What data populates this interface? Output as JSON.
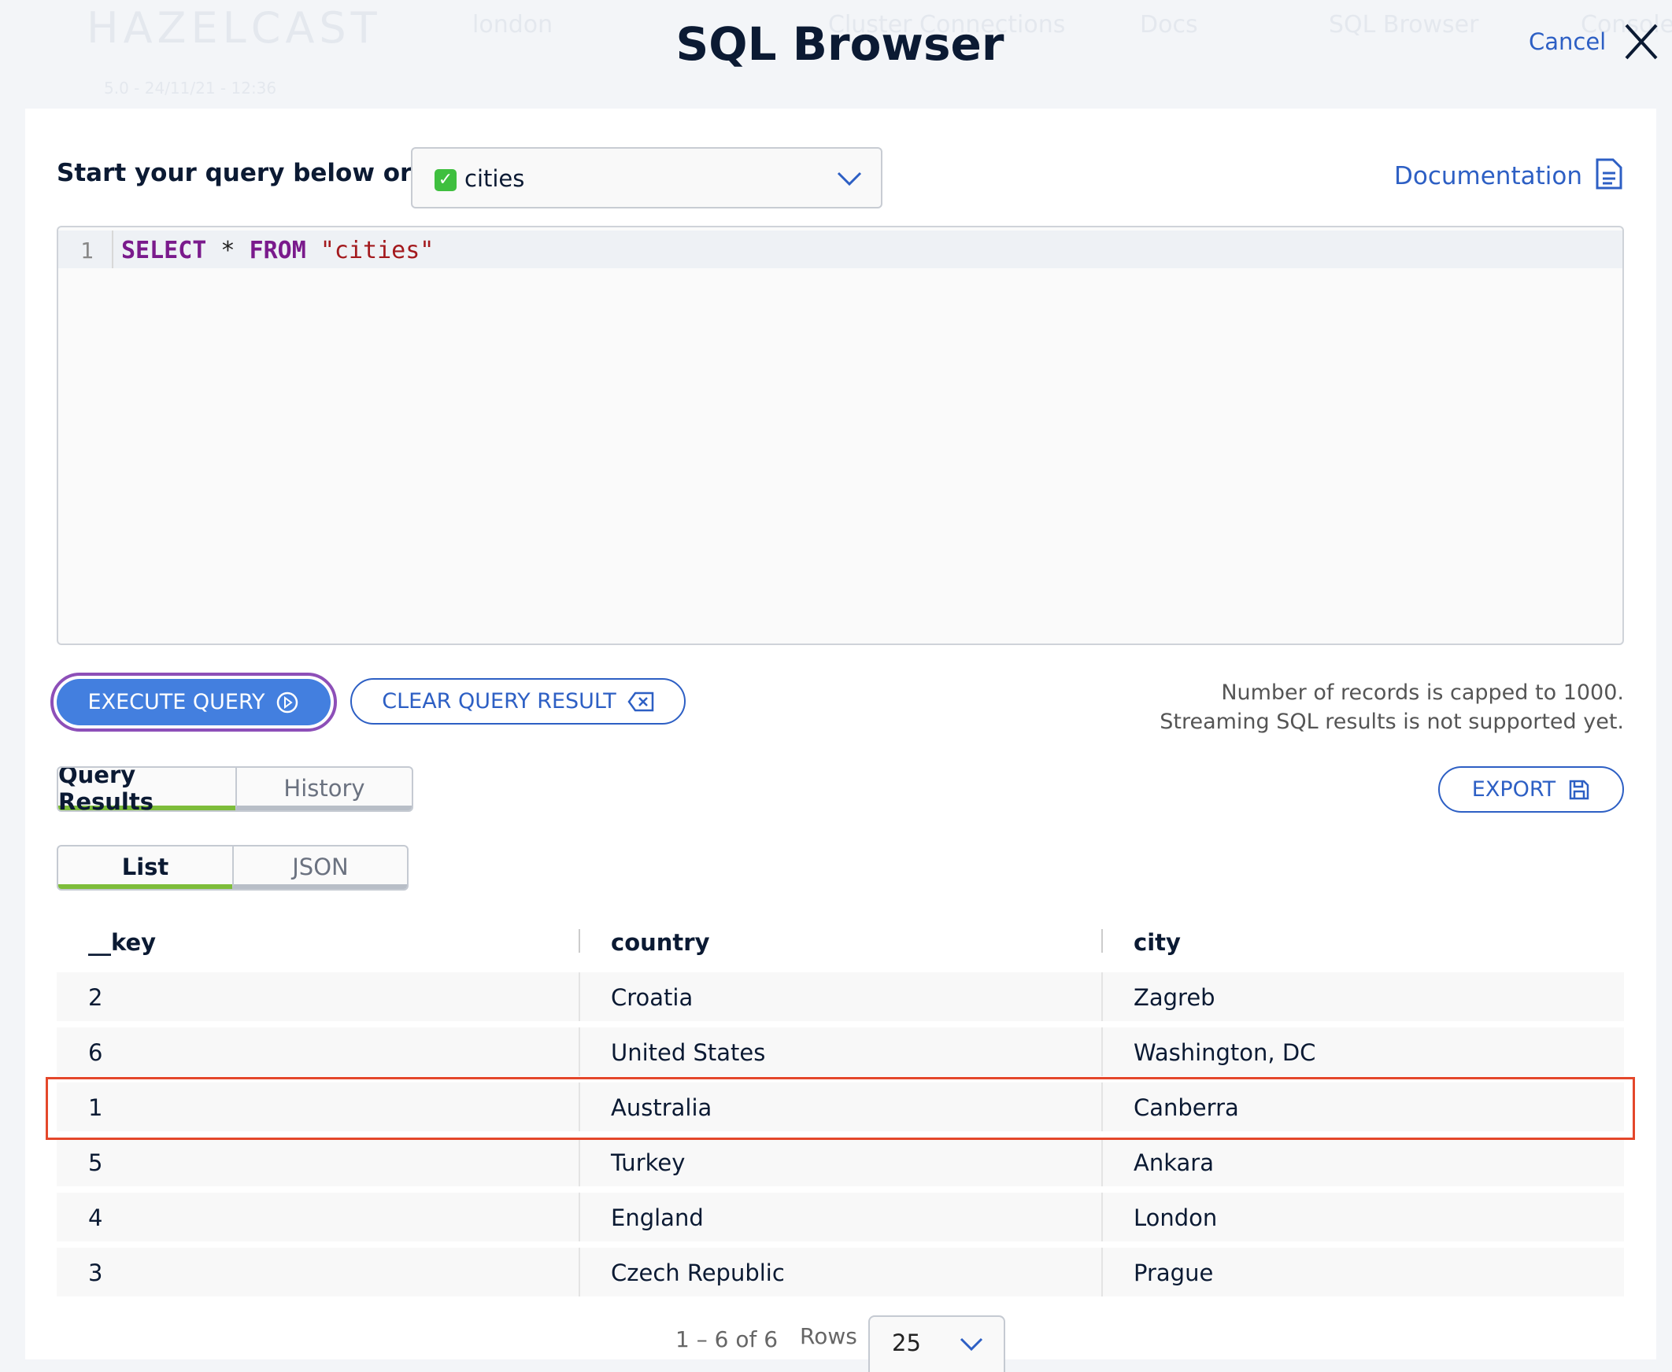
{
  "background": {
    "logo": "HAZELCAST",
    "cluster": "london",
    "nav": [
      "Cluster Connections",
      "Docs",
      "SQL Browser",
      "Console"
    ],
    "version": "5.0 - 24/11/21 - 12:36"
  },
  "modal": {
    "title": "SQL Browser",
    "cancel": "Cancel"
  },
  "query": {
    "label": "Start your query below or",
    "selected_map": "cities",
    "documentation": "Documentation",
    "line_number": "1",
    "code": {
      "kw1": "SELECT",
      "star": " * ",
      "kw2": "FROM",
      "table": " \"cities\""
    }
  },
  "actions": {
    "execute": "EXECUTE QUERY",
    "clear": "CLEAR QUERY RESULT",
    "note1": "Number of records is capped to 1000.",
    "note2": "Streaming SQL results is not supported yet.",
    "export": "EXPORT"
  },
  "tabs": [
    {
      "label": "Query Results",
      "active": true
    },
    {
      "label": "History",
      "active": false
    }
  ],
  "views": [
    {
      "label": "List",
      "active": true
    },
    {
      "label": "JSON",
      "active": false
    }
  ],
  "table": {
    "columns": [
      "__key",
      "country",
      "city"
    ],
    "rows": [
      [
        "2",
        "Croatia",
        "Zagreb"
      ],
      [
        "6",
        "United States",
        "Washington, DC"
      ],
      [
        "1",
        "Australia",
        "Canberra"
      ],
      [
        "5",
        "Turkey",
        "Ankara"
      ],
      [
        "4",
        "England",
        "London"
      ],
      [
        "3",
        "Czech Republic",
        "Prague"
      ]
    ],
    "highlighted_row": 2
  },
  "pagination": {
    "range": "1 – 6 of 6",
    "rows_label": "Rows",
    "rows_per_page": "25"
  },
  "colors": {
    "accent": "#2d5fc4",
    "execute": "#437fdf",
    "focus": "#8d4fb8",
    "active_tab": "#7dbd3a",
    "highlight": "#e4472b"
  }
}
